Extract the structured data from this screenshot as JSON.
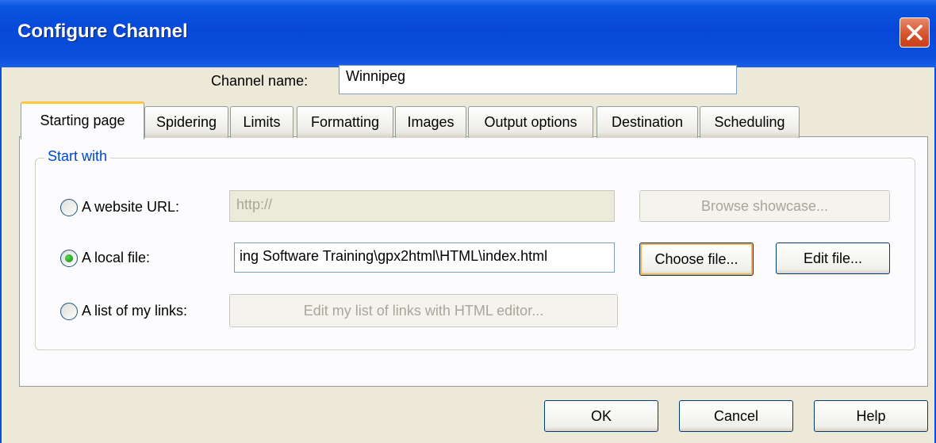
{
  "window": {
    "title": "Configure Channel"
  },
  "channel": {
    "name_label": "Channel name:",
    "name_value": "Winnipeg"
  },
  "tabs": [
    {
      "label": "Starting page",
      "active": true
    },
    {
      "label": "Spidering"
    },
    {
      "label": "Limits"
    },
    {
      "label": "Formatting"
    },
    {
      "label": "Images"
    },
    {
      "label": "Output options"
    },
    {
      "label": "Destination"
    },
    {
      "label": "Scheduling"
    }
  ],
  "group": {
    "legend": "Start with"
  },
  "options": {
    "url": {
      "label": "A website URL:",
      "placeholder": "http://",
      "button": "Browse showcase...",
      "selected": false
    },
    "file": {
      "label": "A local file:",
      "value": "ing Software Training\\gpx2html\\HTML\\index.html",
      "choose_button": "Choose file...",
      "edit_button": "Edit file...",
      "selected": true
    },
    "links": {
      "label": "A list of my links:",
      "button": "Edit my list of links with HTML editor...",
      "selected": false
    }
  },
  "footer": {
    "ok": "OK",
    "cancel": "Cancel",
    "help": "Help"
  },
  "colors": {
    "titlebar": "#0a4fdc",
    "dialog_bg": "#ece9d8",
    "legend": "#0046d5",
    "active_tab_accent": "#ffc83c",
    "radio_checked": "#21a121"
  }
}
